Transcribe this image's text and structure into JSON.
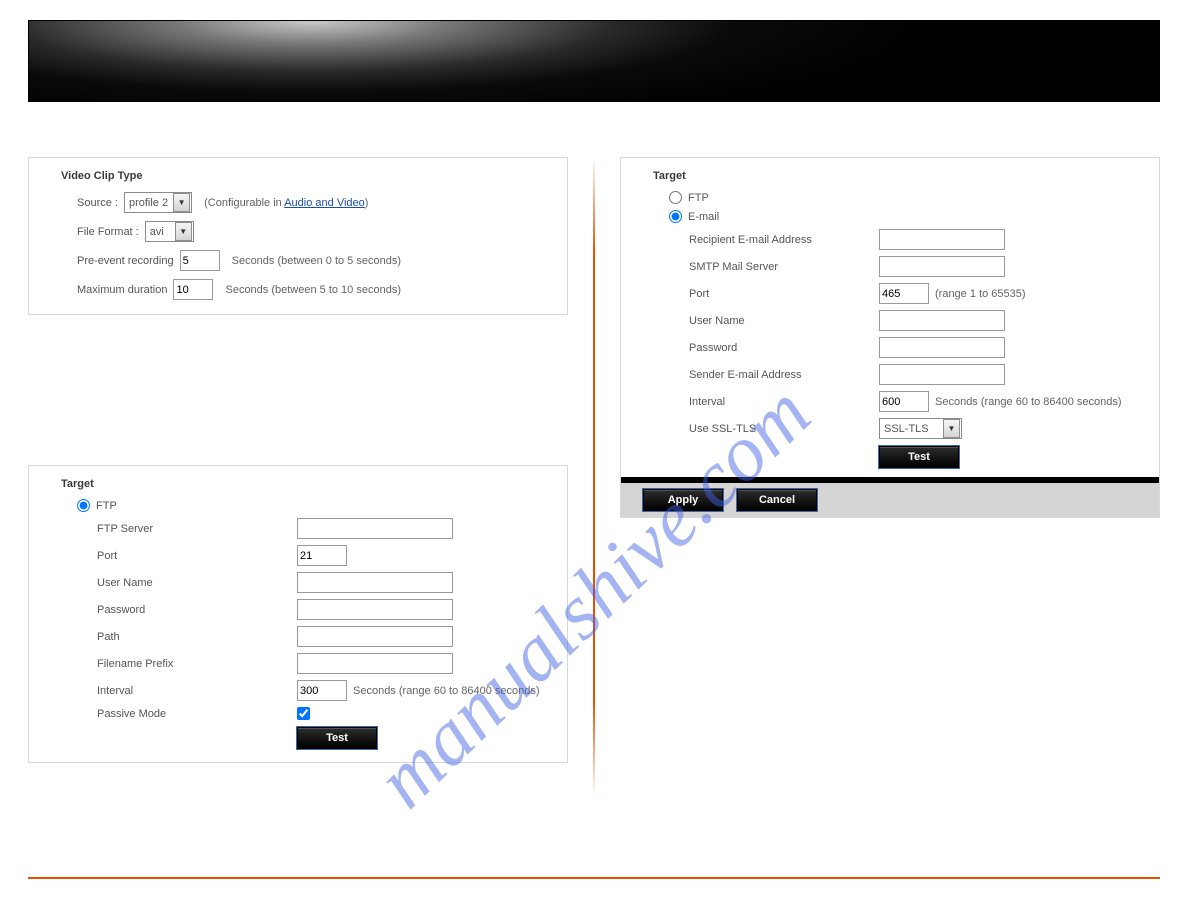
{
  "watermark": "manualshive.com",
  "clip": {
    "title": "Video Clip Type",
    "source_label": "Source :",
    "source_value": "profile 2",
    "source_hint_prefix": "(Configurable in ",
    "source_link": "Audio and Video",
    "source_hint_suffix": ")",
    "format_label": "File Format :",
    "format_value": "avi",
    "preevent_label": "Pre-event recording",
    "preevent_value": "5",
    "preevent_hint": "Seconds  (between 0 to 5 seconds)",
    "maxdur_label": "Maximum duration",
    "maxdur_value": "10",
    "maxdur_hint": "Seconds  (between 5 to 10 seconds)"
  },
  "ftp": {
    "title": "Target",
    "radio_label": "FTP",
    "server_label": "FTP Server",
    "server_value": "",
    "port_label": "Port",
    "port_value": "21",
    "user_label": "User Name",
    "user_value": "",
    "pass_label": "Password",
    "pass_value": "",
    "path_label": "Path",
    "path_value": "",
    "prefix_label": "Filename Prefix",
    "prefix_value": "",
    "interval_label": "Interval",
    "interval_value": "300",
    "interval_hint": "Seconds  (range 60 to 86400 seconds)",
    "passive_label": "Passive Mode",
    "test_label": "Test"
  },
  "email": {
    "title": "Target",
    "radio_ftp": "FTP",
    "radio_email": "E-mail",
    "recipient_label": "Recipient E-mail Address",
    "recipient_value": "",
    "smtp_label": "SMTP Mail Server",
    "smtp_value": "",
    "port_label": "Port",
    "port_value": "465",
    "port_hint": "(range 1 to 65535)",
    "user_label": "User Name",
    "user_value": "",
    "pass_label": "Password",
    "pass_value": "",
    "sender_label": "Sender E-mail Address",
    "sender_value": "",
    "interval_label": "Interval",
    "interval_value": "600",
    "interval_hint": "Seconds  (range 60 to 86400 seconds)",
    "ssl_label": "Use SSL-TLS",
    "ssl_value": "SSL-TLS",
    "test_label": "Test",
    "apply_label": "Apply",
    "cancel_label": "Cancel"
  }
}
